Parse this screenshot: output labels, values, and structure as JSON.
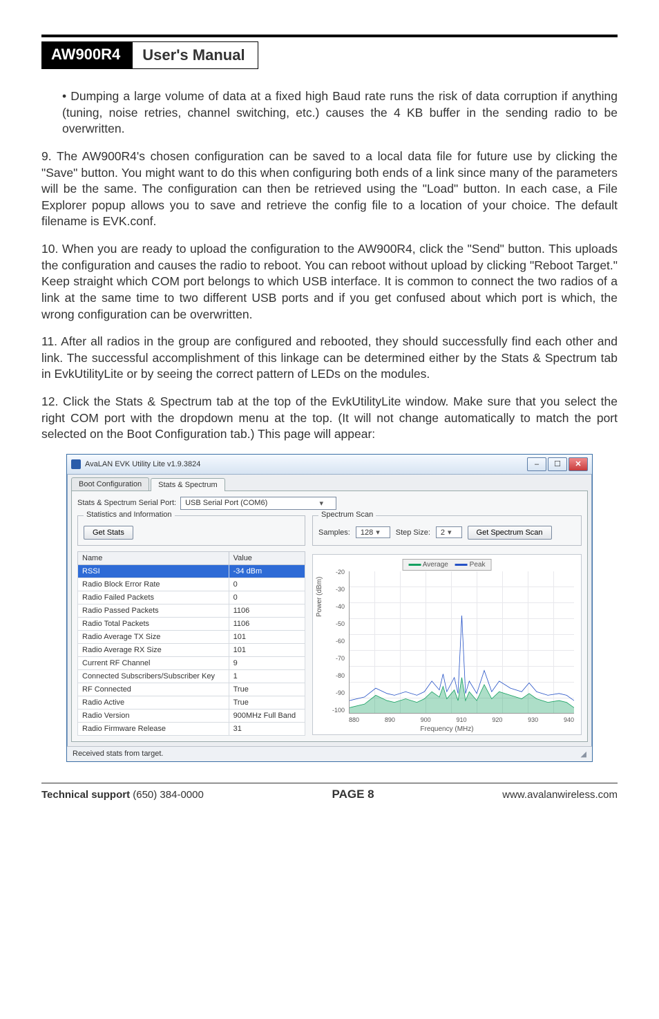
{
  "header": {
    "model": "AW900R4",
    "title": "User's Manual"
  },
  "bullet1": "Dumping a large volume of data at a fixed high Baud rate runs the risk of data corruption if anything (tuning, noise retries, channel switching, etc.) causes the 4 KB buffer in the sending radio to be overwritten.",
  "para9": "9. The AW900R4's chosen configuration can be saved to a local data file for future use by clicking the \"Save\" button. You might want to do this when configuring both ends of a link since many of the parameters will be the same. The configuration can then be retrieved using the \"Load\" button. In each case, a File Explorer popup allows you to save and retrieve the config file to a location of your choice. The default filename is EVK.conf.",
  "para10": "10. When you are ready to upload the configuration to the AW900R4, click the \"Send\" button. This uploads the configuration and causes the radio to reboot. You can reboot without upload by clicking \"Reboot Target.\" Keep straight which COM port belongs to which USB interface. It is common to connect the two radios of a link at the same time to two different USB ports and if you get confused about which port is which, the wrong configuration can be overwritten.",
  "para11": "11. After all radios in the group are configured and rebooted, they should successfully find each other and link.  The successful accomplishment of this linkage can be determined either by the Stats & Spectrum tab in EvkUtilityLite or by seeing the correct pattern of LEDs on the modules.",
  "para12": "12. Click the Stats & Spectrum tab at the top of the EvkUtilityLite window. Make sure that you select the right COM port with the dropdown menu at the top. (It will not change automatically to match the port selected on the Boot Configuration tab.) This page will appear:",
  "window": {
    "title": "AvaLAN EVK Utility Lite v1.9.3824",
    "tabs": {
      "boot": "Boot Configuration",
      "stats": "Stats & Spectrum"
    },
    "portLabel": "Stats & Spectrum Serial Port:",
    "portValue": "USB Serial Port (COM6)",
    "statsGroup": "Statistics and Information",
    "getStats": "Get Stats",
    "col_name": "Name",
    "col_value": "Value",
    "rows": [
      {
        "n": "RSSI",
        "v": "-34 dBm",
        "sel": true
      },
      {
        "n": "Radio Block Error Rate",
        "v": "0"
      },
      {
        "n": "Radio Failed Packets",
        "v": "0"
      },
      {
        "n": "Radio Passed Packets",
        "v": "1106"
      },
      {
        "n": "Radio Total Packets",
        "v": "1106"
      },
      {
        "n": "Radio Average TX Size",
        "v": "101"
      },
      {
        "n": "Radio Average RX Size",
        "v": "101"
      },
      {
        "n": "Current RF Channel",
        "v": "9"
      },
      {
        "n": "Connected Subscribers/Subscriber Key",
        "v": "1"
      },
      {
        "n": "RF Connected",
        "v": "True"
      },
      {
        "n": "Radio Active",
        "v": "True"
      },
      {
        "n": "Radio Version",
        "v": "900MHz Full Band"
      },
      {
        "n": "Radio Firmware Release",
        "v": "31"
      }
    ],
    "spectrum": {
      "group": "Spectrum Scan",
      "samplesLabel": "Samples:",
      "samplesValue": "128",
      "stepLabel": "Step Size:",
      "stepValue": "2",
      "scanBtn": "Get Spectrum Scan",
      "legendAvg": "Average",
      "legendPeak": "Peak",
      "ylabel": "Power (dBm)",
      "xlabel": "Frequency (MHz)"
    },
    "status": "Received stats from target."
  },
  "chart_data": {
    "type": "line",
    "xlabel": "Frequency (MHz)",
    "ylabel": "Power (dBm)",
    "ylim": [
      -100,
      -20
    ],
    "xlim": [
      880,
      940
    ],
    "xticks": [
      880,
      890,
      900,
      910,
      920,
      930,
      940
    ],
    "yticks": [
      -20,
      -30,
      -40,
      -50,
      -60,
      -70,
      -80,
      -90,
      -100
    ],
    "series": [
      {
        "name": "Average",
        "color": "#14a060",
        "x": [
          880,
          884,
          887,
          890,
          892,
          895,
          898,
          900,
          902,
          904,
          905,
          906,
          908,
          909,
          910,
          911,
          912,
          914,
          916,
          918,
          920,
          923,
          926,
          928,
          930,
          933,
          936,
          938,
          940
        ],
        "values": [
          -97,
          -95,
          -90,
          -93,
          -94,
          -92,
          -94,
          -92,
          -88,
          -91,
          -85,
          -92,
          -87,
          -93,
          -80,
          -93,
          -88,
          -93,
          -84,
          -92,
          -88,
          -90,
          -92,
          -89,
          -92,
          -94,
          -93,
          -94,
          -97
        ]
      },
      {
        "name": "Peak",
        "color": "#2451c6",
        "x": [
          880,
          884,
          887,
          890,
          892,
          895,
          898,
          900,
          902,
          904,
          905,
          906,
          908,
          909,
          910,
          911,
          912,
          914,
          916,
          918,
          920,
          923,
          926,
          928,
          930,
          933,
          936,
          938,
          940
        ],
        "values": [
          -93,
          -91,
          -86,
          -89,
          -90,
          -88,
          -90,
          -88,
          -82,
          -87,
          -78,
          -88,
          -80,
          -89,
          -45,
          -89,
          -82,
          -89,
          -76,
          -88,
          -82,
          -86,
          -88,
          -83,
          -88,
          -90,
          -89,
          -90,
          -93
        ]
      }
    ]
  },
  "footer": {
    "left": "Technical support (650) 384-0000",
    "page": "PAGE 8",
    "right": "www.avalanwireless.com"
  }
}
